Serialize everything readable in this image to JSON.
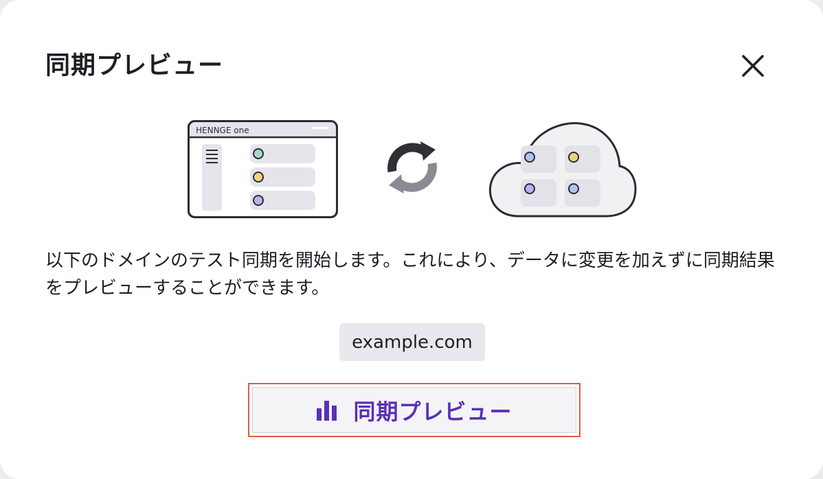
{
  "dialog": {
    "title": "同期プレビュー",
    "close_icon": "close-icon",
    "illustration": {
      "app_window_brand": "HENNGE one",
      "sync_icon": "sync-arrows-icon",
      "cloud_icon": "cloud-icon",
      "dot_colors": [
        "#9fd8cb",
        "#f1d27a",
        "#b7b3ee",
        "#a9c7ef"
      ]
    },
    "description": "以下のドメインのテスト同期を開始します。これにより、データに変更を加えずに同期結果をプレビューすることができます。",
    "domain": "example.com",
    "preview_button": {
      "icon": "bar-chart-icon",
      "label": "同期プレビュー"
    }
  },
  "colors": {
    "accent": "#5b2fb8",
    "focus_outline": "#e35a3f",
    "chip_bg": "#e9e8ee",
    "text": "#1e1e24"
  }
}
